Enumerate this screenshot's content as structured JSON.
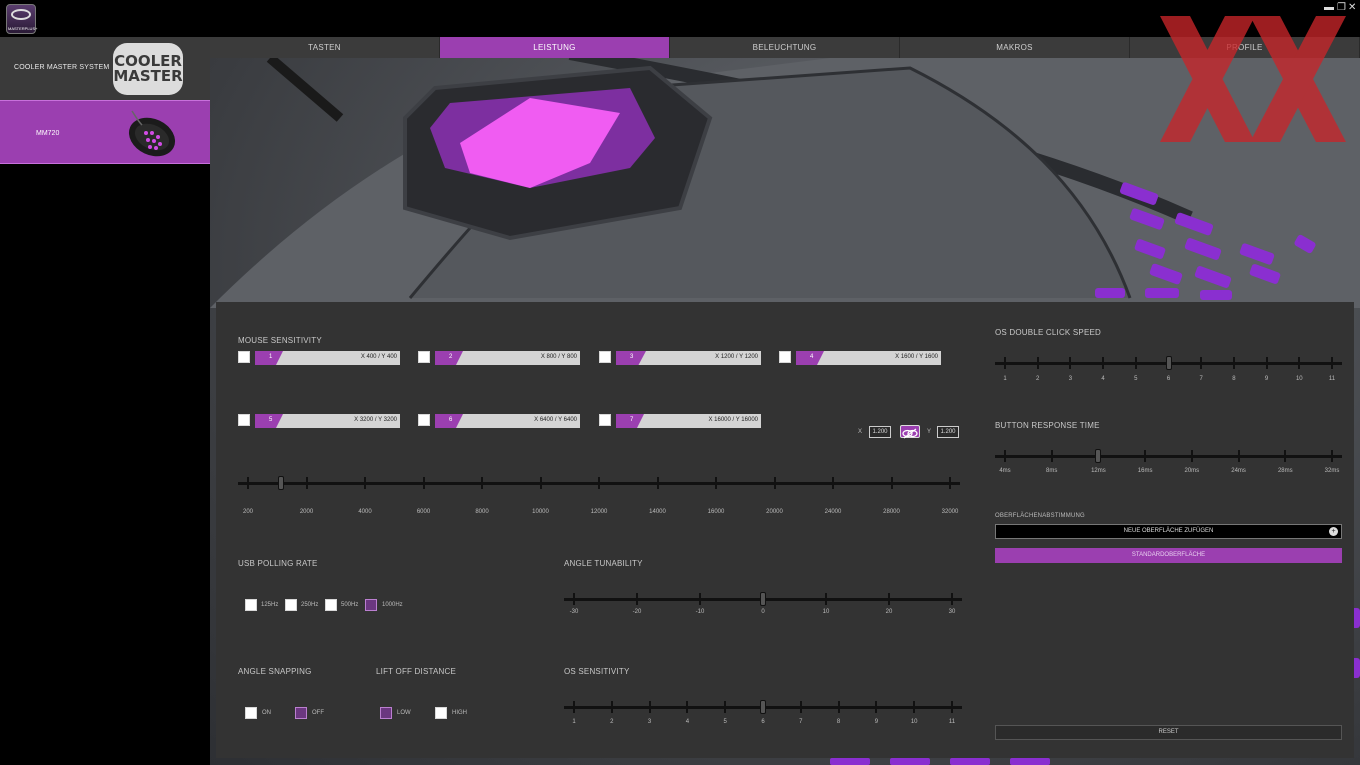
{
  "app": {
    "logo_text": "MASTERPLUS+"
  },
  "window": {
    "minimize": "▬",
    "restore": "❐",
    "close": "✕"
  },
  "sidebar": {
    "system_label": "COOLER MASTER SYSTEM",
    "brand_logo_text": "COOLER MASTER",
    "device_label": "MM720"
  },
  "tabs": [
    "TASTEN",
    "LEISTUNG",
    "BELEUCHTUNG",
    "MAKROS",
    "PROFILE"
  ],
  "active_tab": "LEISTUNG",
  "mouse_sensitivity": {
    "title": "MOUSE SENSITIVITY",
    "levels": [
      {
        "n": "1",
        "value": "X 400 / Y 400",
        "checked": false
      },
      {
        "n": "2",
        "value": "X 800 / Y 800",
        "checked": false
      },
      {
        "n": "3",
        "value": "X 1200 / Y 1200",
        "checked": false,
        "active": true
      },
      {
        "n": "4",
        "value": "X 1600 / Y 1600",
        "checked": false
      },
      {
        "n": "5",
        "value": "X 3200 / Y 3200",
        "checked": false
      },
      {
        "n": "6",
        "value": "X 6400 / Y 6400",
        "checked": false
      },
      {
        "n": "7",
        "value": "X 16000 / Y 16000",
        "checked": false
      }
    ],
    "x_label": "X",
    "x_value": "1.200",
    "y_label": "Y",
    "y_value": "1.200",
    "slider_ticks": [
      "200",
      "2000",
      "4000",
      "6000",
      "8000",
      "10000",
      "12000",
      "14000",
      "16000",
      "20000",
      "24000",
      "28000",
      "32000"
    ],
    "slider_value": 1200
  },
  "usb_polling": {
    "title": "USB POLLING RATE",
    "options": [
      {
        "label": "125Hz",
        "checked": false
      },
      {
        "label": "250Hz",
        "checked": false
      },
      {
        "label": "500Hz",
        "checked": false
      },
      {
        "label": "1000Hz",
        "checked": true
      }
    ]
  },
  "angle_tunability": {
    "title": "ANGLE TUNABILITY",
    "ticks": [
      "-30",
      "-20",
      "-10",
      "0",
      "10",
      "20",
      "30"
    ],
    "value": 0
  },
  "angle_snapping": {
    "title": "ANGLE SNAPPING",
    "options": [
      {
        "label": "ON",
        "checked": false
      },
      {
        "label": "OFF",
        "checked": true
      }
    ]
  },
  "lift_off": {
    "title": "LIFT OFF DISTANCE",
    "options": [
      {
        "label": "LOW",
        "checked": true
      },
      {
        "label": "HIGH",
        "checked": false
      }
    ]
  },
  "os_sensitivity": {
    "title": "OS SENSITIVITY",
    "ticks": [
      "1",
      "2",
      "3",
      "4",
      "5",
      "6",
      "7",
      "8",
      "9",
      "10",
      "11"
    ],
    "value": 6
  },
  "os_double_click": {
    "title": "OS DOUBLE CLICK SPEED",
    "ticks": [
      "1",
      "2",
      "3",
      "4",
      "5",
      "6",
      "7",
      "8",
      "9",
      "10",
      "11"
    ],
    "value": 6
  },
  "button_response": {
    "title": "BUTTON RESPONSE TIME",
    "ticks": [
      "4ms",
      "8ms",
      "12ms",
      "16ms",
      "20ms",
      "24ms",
      "28ms",
      "32ms"
    ],
    "value": "12ms"
  },
  "surface": {
    "title": "OBERFLÄCHENABSTIMMUNG",
    "add_label": "NEUE OBERFLÄCHE ZUFÜGEN",
    "standard_label": "STANDARDOBERFLÄCHE",
    "reset_label": "RESET"
  },
  "colors": {
    "accent": "#9b3fb0",
    "panel": "#333333"
  }
}
